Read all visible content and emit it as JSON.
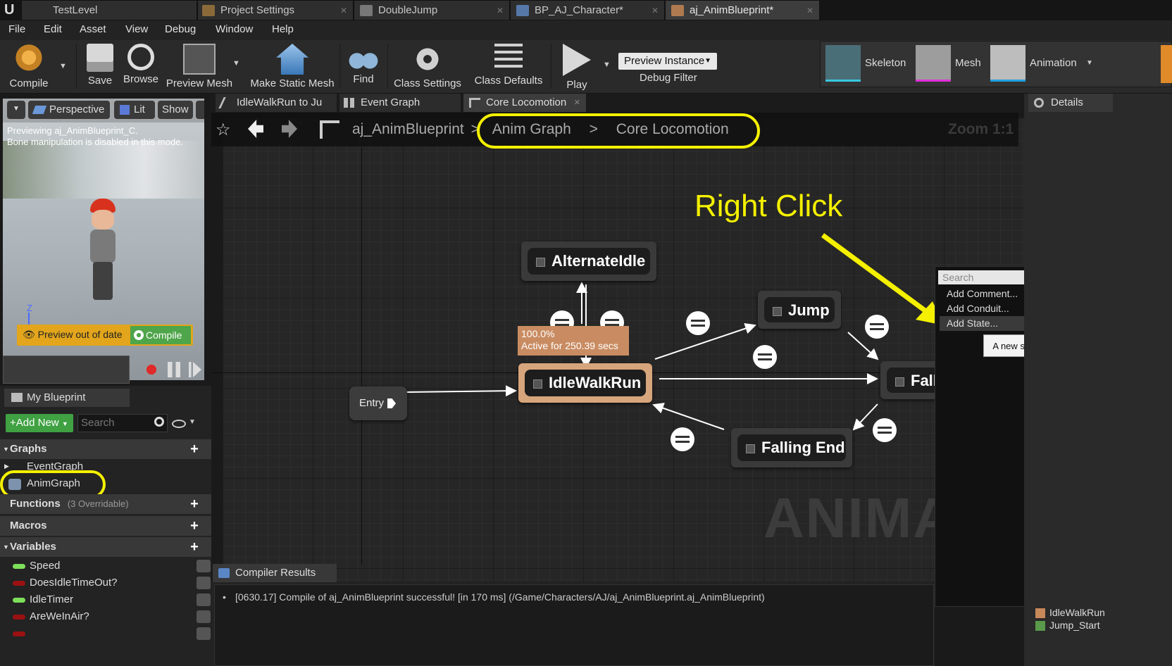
{
  "tabs": [
    {
      "label": "TestLevel"
    },
    {
      "label": "Project Settings"
    },
    {
      "label": "DoubleJump"
    },
    {
      "label": "BP_AJ_Character*"
    },
    {
      "label": "aj_AnimBlueprint*"
    }
  ],
  "menu": [
    "File",
    "Edit",
    "Asset",
    "View",
    "Debug",
    "Window",
    "Help"
  ],
  "toolbar": {
    "compile": "Compile",
    "save": "Save",
    "browse": "Browse",
    "preview_mesh": "Preview Mesh",
    "make_static_mesh": "Make Static Mesh",
    "find": "Find",
    "class_settings": "Class Settings",
    "class_defaults": "Class Defaults",
    "play": "Play",
    "debug_select": "Preview Instance",
    "debug_filter": "Debug Filter",
    "skeleton": "Skeleton",
    "mesh": "Mesh",
    "animation": "Animation"
  },
  "viewport": {
    "perspective": "Perspective",
    "lit": "Lit",
    "show": "Show",
    "info_line1": "Previewing aj_AnimBlueprint_C.",
    "info_line2": "Bone manipulation is disabled in this mode.",
    "axis": "Z",
    "out_of_date": "Preview out of date",
    "compile": "Compile"
  },
  "graph_tabs": [
    "IdleWalkRun to Ju",
    "Event Graph",
    "Core Locomotion"
  ],
  "breadcrumb": {
    "root": "aj_AnimBlueprint",
    "sep": ">",
    "level1": "Anim Graph",
    "level2": "Core Locomotion"
  },
  "zoom": "Zoom 1:1",
  "watermark": "ANIMAT",
  "annotation": "Right Click",
  "nodes": {
    "alternate_idle": "AlternateIdle",
    "jump": "Jump",
    "idle_walk_run": "IdleWalkRun",
    "falling": "Falli",
    "falling_end": "Falling End",
    "entry": "Entry"
  },
  "active_state": {
    "percent": "100.0%",
    "active": "Active for 250.39 secs"
  },
  "context_menu": {
    "search_placeholder": "Search",
    "items": [
      "Add Comment...",
      "Add Conduit...",
      "Add State..."
    ],
    "tooltip": "A new state"
  },
  "details": {
    "title": "Details",
    "list": [
      "IdleWalkRun",
      "Jump_Start"
    ]
  },
  "my_blueprint": {
    "title": "My Blueprint",
    "add_new": "Add New",
    "search_placeholder": "Search",
    "graphs": "Graphs",
    "event_graph": "EventGraph",
    "anim_graph": "AnimGraph",
    "functions": "Functions",
    "functions_sub": "(3 Overridable)",
    "macros": "Macros",
    "variables": "Variables",
    "vars": [
      {
        "name": "Speed",
        "color": "#7ee05a"
      },
      {
        "name": "DoesIdleTimeOut?",
        "color": "#9b1111"
      },
      {
        "name": "IdleTimer",
        "color": "#7ee05a"
      },
      {
        "name": "AreWeInAir?",
        "color": "#9b1111"
      }
    ]
  },
  "compiler": {
    "tab": "Compiler Results",
    "message": "[0630.17] Compile of aj_AnimBlueprint successful! [in 170 ms] (/Game/Characters/AJ/aj_AnimBlueprint.aj_AnimBlueprint)"
  }
}
